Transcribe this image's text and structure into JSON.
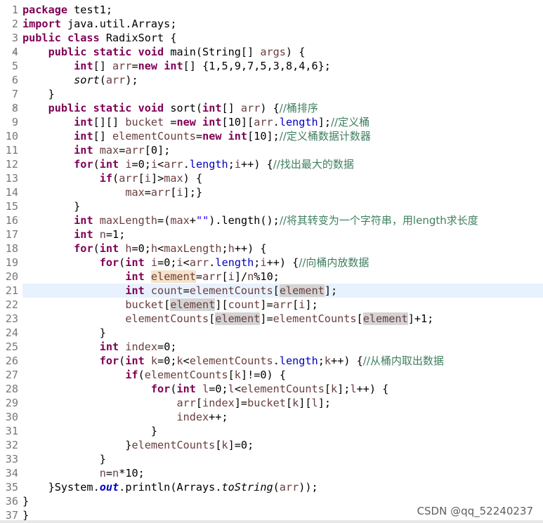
{
  "editor": {
    "current_line": 21,
    "gutter": [
      "1",
      "2",
      "3",
      "4",
      "5",
      "6",
      "7",
      "8",
      "9",
      "10",
      "11",
      "12",
      "13",
      "14",
      "15",
      "16",
      "17",
      "18",
      "19",
      "20",
      "21",
      "22",
      "23",
      "24",
      "25",
      "26",
      "27",
      "28",
      "29",
      "30",
      "31",
      "32",
      "33",
      "34",
      "35",
      "36",
      "37"
    ],
    "fold_markers": [
      "4",
      "8"
    ],
    "lines": [
      [
        [
          "kw",
          "package"
        ],
        [
          "p",
          " test1;"
        ]
      ],
      [
        [
          "kw",
          "import"
        ],
        [
          "p",
          " java.util.Arrays;"
        ]
      ],
      [
        [
          "kw",
          "public class"
        ],
        [
          "p",
          " RadixSort {"
        ]
      ],
      [
        [
          "p",
          "    "
        ],
        [
          "kw",
          "public static void"
        ],
        [
          "p",
          " main(String[] "
        ],
        [
          "var",
          "args"
        ],
        [
          "p",
          ") {"
        ]
      ],
      [
        [
          "p",
          "        "
        ],
        [
          "kw",
          "int"
        ],
        [
          "p",
          "[] "
        ],
        [
          "var",
          "arr"
        ],
        [
          "p",
          "="
        ],
        [
          "kw",
          "new int"
        ],
        [
          "p",
          "[] {1,5,9,7,5,3,8,4,6};"
        ]
      ],
      [
        [
          "p",
          "        "
        ],
        [
          "it",
          "sort"
        ],
        [
          "p",
          "("
        ],
        [
          "var",
          "arr"
        ],
        [
          "p",
          ");"
        ]
      ],
      [
        [
          "p",
          "    }"
        ]
      ],
      [
        [
          "p",
          "    "
        ],
        [
          "kw",
          "public static void"
        ],
        [
          "p",
          " sort("
        ],
        [
          "kw",
          "int"
        ],
        [
          "p",
          "[] "
        ],
        [
          "var",
          "arr"
        ],
        [
          "p",
          ") {"
        ],
        [
          "cm",
          "//桶排序"
        ]
      ],
      [
        [
          "p",
          "        "
        ],
        [
          "kw",
          "int"
        ],
        [
          "p",
          "[][] "
        ],
        [
          "var",
          "bucket"
        ],
        [
          "p",
          " ="
        ],
        [
          "kw",
          "new int"
        ],
        [
          "p",
          "[10]["
        ],
        [
          "var",
          "arr"
        ],
        [
          "p",
          "."
        ],
        [
          "fld",
          "length"
        ],
        [
          "p",
          "];"
        ],
        [
          "cm",
          "//定义桶"
        ]
      ],
      [
        [
          "p",
          "        "
        ],
        [
          "kw",
          "int"
        ],
        [
          "p",
          "[] "
        ],
        [
          "var",
          "elementCounts"
        ],
        [
          "p",
          "="
        ],
        [
          "kw",
          "new int"
        ],
        [
          "p",
          "[10];"
        ],
        [
          "cm",
          "//定义桶数据计数器"
        ]
      ],
      [
        [
          "p",
          "        "
        ],
        [
          "kw",
          "int"
        ],
        [
          "p",
          " "
        ],
        [
          "var",
          "max"
        ],
        [
          "p",
          "="
        ],
        [
          "var",
          "arr"
        ],
        [
          "p",
          "[0];"
        ]
      ],
      [
        [
          "p",
          "        "
        ],
        [
          "kw",
          "for"
        ],
        [
          "p",
          "("
        ],
        [
          "kw",
          "int"
        ],
        [
          "p",
          " "
        ],
        [
          "var",
          "i"
        ],
        [
          "p",
          "=0;"
        ],
        [
          "var",
          "i"
        ],
        [
          "p",
          "<"
        ],
        [
          "var",
          "arr"
        ],
        [
          "p",
          "."
        ],
        [
          "fld",
          "length"
        ],
        [
          "p",
          ";"
        ],
        [
          "var",
          "i"
        ],
        [
          "p",
          "++) {"
        ],
        [
          "cm",
          "//找出最大的数据"
        ]
      ],
      [
        [
          "p",
          "            "
        ],
        [
          "kw",
          "if"
        ],
        [
          "p",
          "("
        ],
        [
          "var",
          "arr"
        ],
        [
          "p",
          "["
        ],
        [
          "var",
          "i"
        ],
        [
          "p",
          "]>"
        ],
        [
          "var",
          "max"
        ],
        [
          "p",
          ") {"
        ]
      ],
      [
        [
          "p",
          "                "
        ],
        [
          "var",
          "max"
        ],
        [
          "p",
          "="
        ],
        [
          "var",
          "arr"
        ],
        [
          "p",
          "["
        ],
        [
          "var",
          "i"
        ],
        [
          "p",
          "];}"
        ]
      ],
      [
        [
          "p",
          "        }"
        ]
      ],
      [
        [
          "p",
          "        "
        ],
        [
          "kw",
          "int"
        ],
        [
          "p",
          " "
        ],
        [
          "var",
          "maxLength"
        ],
        [
          "p",
          "=("
        ],
        [
          "var",
          "max"
        ],
        [
          "p",
          "+"
        ],
        [
          "str",
          "\"\""
        ],
        [
          "p",
          ").length();"
        ],
        [
          "cm",
          "//将其转变为一个字符串，用length求长度"
        ]
      ],
      [
        [
          "p",
          "        "
        ],
        [
          "kw",
          "int"
        ],
        [
          "p",
          " "
        ],
        [
          "var",
          "n"
        ],
        [
          "p",
          "=1;"
        ]
      ],
      [
        [
          "p",
          "        "
        ],
        [
          "kw",
          "for"
        ],
        [
          "p",
          "("
        ],
        [
          "kw",
          "int"
        ],
        [
          "p",
          " "
        ],
        [
          "var",
          "h"
        ],
        [
          "p",
          "=0;"
        ],
        [
          "var",
          "h"
        ],
        [
          "p",
          "<"
        ],
        [
          "var",
          "maxLength"
        ],
        [
          "p",
          ";"
        ],
        [
          "var",
          "h"
        ],
        [
          "p",
          "++) {"
        ]
      ],
      [
        [
          "p",
          "            "
        ],
        [
          "kw",
          "for"
        ],
        [
          "p",
          "("
        ],
        [
          "kw",
          "int"
        ],
        [
          "p",
          " "
        ],
        [
          "var",
          "i"
        ],
        [
          "p",
          "=0;"
        ],
        [
          "var",
          "i"
        ],
        [
          "p",
          "<"
        ],
        [
          "var",
          "arr"
        ],
        [
          "p",
          "."
        ],
        [
          "fld",
          "length"
        ],
        [
          "p",
          ";"
        ],
        [
          "var",
          "i"
        ],
        [
          "p",
          "++) {"
        ],
        [
          "cm",
          "//向桶内放数据"
        ]
      ],
      [
        [
          "p",
          "                "
        ],
        [
          "kw",
          "int"
        ],
        [
          "p",
          " "
        ],
        [
          "hlw",
          "element"
        ],
        [
          "p",
          "="
        ],
        [
          "var",
          "arr"
        ],
        [
          "p",
          "["
        ],
        [
          "var",
          "i"
        ],
        [
          "p",
          "]/"
        ],
        [
          "var",
          "n"
        ],
        [
          "p",
          "%10;"
        ]
      ],
      [
        [
          "p",
          "                "
        ],
        [
          "kw",
          "int"
        ],
        [
          "p",
          " "
        ],
        [
          "var",
          "count"
        ],
        [
          "p",
          "="
        ],
        [
          "var",
          "elementCounts"
        ],
        [
          "p",
          "["
        ],
        [
          "hlr",
          "element"
        ],
        [
          "p",
          "];"
        ]
      ],
      [
        [
          "p",
          "                "
        ],
        [
          "var",
          "bucket"
        ],
        [
          "p",
          "["
        ],
        [
          "hlr",
          "element"
        ],
        [
          "p",
          "]["
        ],
        [
          "var",
          "count"
        ],
        [
          "p",
          "]="
        ],
        [
          "var",
          "arr"
        ],
        [
          "p",
          "["
        ],
        [
          "var",
          "i"
        ],
        [
          "p",
          "];"
        ]
      ],
      [
        [
          "p",
          "                "
        ],
        [
          "var",
          "elementCounts"
        ],
        [
          "p",
          "["
        ],
        [
          "hlr",
          "element"
        ],
        [
          "p",
          "]="
        ],
        [
          "var",
          "elementCounts"
        ],
        [
          "p",
          "["
        ],
        [
          "hlr",
          "element"
        ],
        [
          "p",
          "]+1;"
        ]
      ],
      [
        [
          "p",
          "            }"
        ]
      ],
      [
        [
          "p",
          "            "
        ],
        [
          "kw",
          "int"
        ],
        [
          "p",
          " "
        ],
        [
          "var",
          "index"
        ],
        [
          "p",
          "=0;"
        ]
      ],
      [
        [
          "p",
          "            "
        ],
        [
          "kw",
          "for"
        ],
        [
          "p",
          "("
        ],
        [
          "kw",
          "int"
        ],
        [
          "p",
          " "
        ],
        [
          "var",
          "k"
        ],
        [
          "p",
          "=0;"
        ],
        [
          "var",
          "k"
        ],
        [
          "p",
          "<"
        ],
        [
          "var",
          "elementCounts"
        ],
        [
          "p",
          "."
        ],
        [
          "fld",
          "length"
        ],
        [
          "p",
          ";"
        ],
        [
          "var",
          "k"
        ],
        [
          "p",
          "++) {"
        ],
        [
          "cm",
          "//从桶内取出数据"
        ]
      ],
      [
        [
          "p",
          "                "
        ],
        [
          "kw",
          "if"
        ],
        [
          "p",
          "("
        ],
        [
          "var",
          "elementCounts"
        ],
        [
          "p",
          "["
        ],
        [
          "var",
          "k"
        ],
        [
          "p",
          "]!=0) {"
        ]
      ],
      [
        [
          "p",
          "                    "
        ],
        [
          "kw",
          "for"
        ],
        [
          "p",
          "("
        ],
        [
          "kw",
          "int"
        ],
        [
          "p",
          " "
        ],
        [
          "var",
          "l"
        ],
        [
          "p",
          "=0;"
        ],
        [
          "var",
          "l"
        ],
        [
          "p",
          "<"
        ],
        [
          "var",
          "elementCounts"
        ],
        [
          "p",
          "["
        ],
        [
          "var",
          "k"
        ],
        [
          "p",
          "];"
        ],
        [
          "var",
          "l"
        ],
        [
          "p",
          "++) {"
        ]
      ],
      [
        [
          "p",
          "                        "
        ],
        [
          "var",
          "arr"
        ],
        [
          "p",
          "["
        ],
        [
          "var",
          "index"
        ],
        [
          "p",
          "]="
        ],
        [
          "var",
          "bucket"
        ],
        [
          "p",
          "["
        ],
        [
          "var",
          "k"
        ],
        [
          "p",
          "]["
        ],
        [
          "var",
          "l"
        ],
        [
          "p",
          "];"
        ]
      ],
      [
        [
          "p",
          "                        "
        ],
        [
          "var",
          "index"
        ],
        [
          "p",
          "++;"
        ]
      ],
      [
        [
          "p",
          "                    }"
        ]
      ],
      [
        [
          "p",
          "                }"
        ],
        [
          "var",
          "elementCounts"
        ],
        [
          "p",
          "["
        ],
        [
          "var",
          "k"
        ],
        [
          "p",
          "]=0;"
        ]
      ],
      [
        [
          "p",
          "            }"
        ]
      ],
      [
        [
          "p",
          "            "
        ],
        [
          "var",
          "n"
        ],
        [
          "p",
          "="
        ],
        [
          "var",
          "n"
        ],
        [
          "p",
          "*10;"
        ]
      ],
      [
        [
          "p",
          "    }System."
        ],
        [
          "sfld",
          "out"
        ],
        [
          "p",
          ".println(Arrays."
        ],
        [
          "it",
          "toString"
        ],
        [
          "p",
          "("
        ],
        [
          "var",
          "arr"
        ],
        [
          "p",
          "));"
        ]
      ],
      [
        [
          "p",
          "}"
        ]
      ],
      [
        [
          "p",
          "}"
        ]
      ]
    ]
  },
  "watermark": "CSDN @qq_52240237",
  "colors": {
    "keyword": "#7f0055",
    "local_variable": "#6a3e3e",
    "field": "#0000c0",
    "string": "#2a00ff",
    "comment": "#3f7f5f",
    "current_line_bg": "#e8f2fe",
    "write_occurrence_bg": "#f6e3c8",
    "read_occurrence_bg": "#d4d4d4"
  }
}
